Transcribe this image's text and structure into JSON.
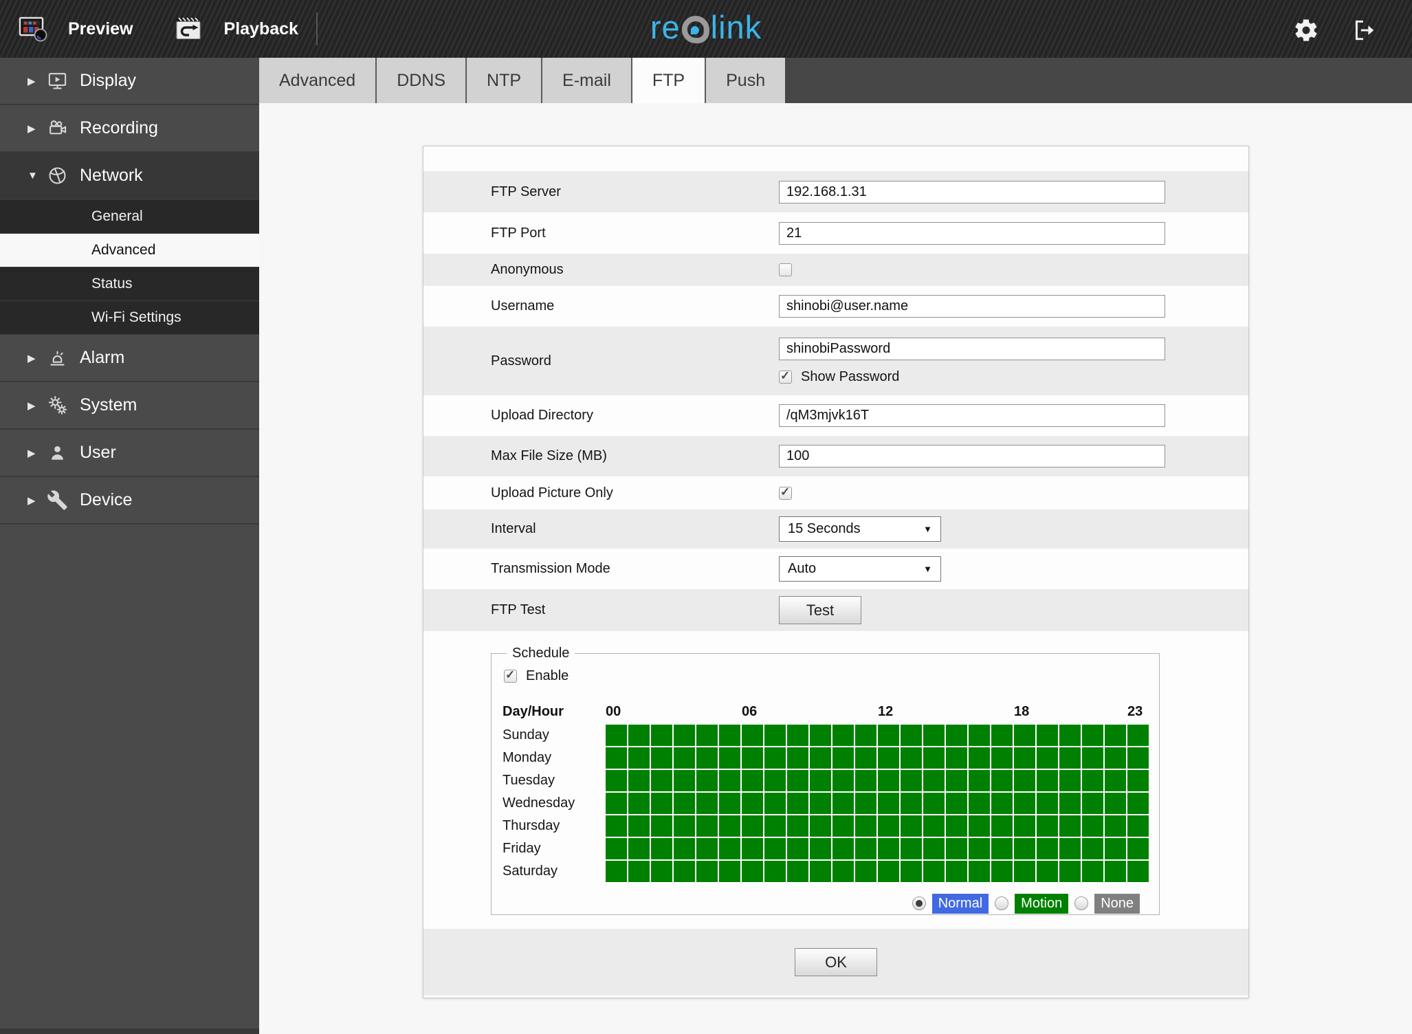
{
  "topbar": {
    "preview_label": "Preview",
    "playback_label": "Playback",
    "brand": {
      "left": "re",
      "o": "o",
      "right": "link",
      "full": "reolink"
    },
    "icons": [
      "preview-icon",
      "playback-icon",
      "settings-gear-icon",
      "logout-icon"
    ]
  },
  "sidebar": {
    "items": [
      {
        "label": "Display",
        "icon": "display-icon",
        "expanded": false
      },
      {
        "label": "Recording",
        "icon": "recording-icon",
        "expanded": false
      },
      {
        "label": "Network",
        "icon": "network-icon",
        "expanded": true,
        "children": [
          {
            "label": "General",
            "selected": false
          },
          {
            "label": "Advanced",
            "selected": true
          },
          {
            "label": "Status",
            "selected": false
          },
          {
            "label": "Wi-Fi Settings",
            "selected": false
          }
        ]
      },
      {
        "label": "Alarm",
        "icon": "alarm-icon",
        "expanded": false
      },
      {
        "label": "System",
        "icon": "system-icon",
        "expanded": false
      },
      {
        "label": "User",
        "icon": "user-icon",
        "expanded": false
      },
      {
        "label": "Device",
        "icon": "device-icon",
        "expanded": false
      }
    ]
  },
  "tabs": {
    "items": [
      "Advanced",
      "DDNS",
      "NTP",
      "E-mail",
      "FTP",
      "Push"
    ],
    "active": "FTP"
  },
  "form": {
    "rows": [
      {
        "label": "FTP Server",
        "type": "text",
        "value": "192.168.1.31"
      },
      {
        "label": "FTP Port",
        "type": "text",
        "value": "21"
      },
      {
        "label": "Anonymous",
        "type": "checkbox",
        "checked": false
      },
      {
        "label": "Username",
        "type": "text",
        "value": "shinobi@user.name"
      },
      {
        "label": "Password",
        "type": "text",
        "value": "shinobiPassword",
        "sub": {
          "label": "Show Password",
          "checked": true
        }
      },
      {
        "label": "Upload Directory",
        "type": "text",
        "value": "/qM3mjvk16T"
      },
      {
        "label": "Max File Size (MB)",
        "type": "text",
        "value": "100"
      },
      {
        "label": "Upload Picture Only",
        "type": "checkbox",
        "checked": true
      },
      {
        "label": "Interval",
        "type": "select",
        "value": "15 Seconds"
      },
      {
        "label": "Transmission Mode",
        "type": "select",
        "value": "Auto"
      },
      {
        "label": "FTP Test",
        "type": "button",
        "button_label": "Test"
      }
    ]
  },
  "schedule": {
    "legend": "Schedule",
    "enable_label": "Enable",
    "enable_checked": true,
    "day_hour_label": "Day/Hour",
    "hour_ticks": [
      {
        "label": "00",
        "col": 0
      },
      {
        "label": "06",
        "col": 6
      },
      {
        "label": "12",
        "col": 12
      },
      {
        "label": "18",
        "col": 18
      },
      {
        "label": "23",
        "col": 23
      }
    ],
    "days": [
      "Sunday",
      "Monday",
      "Tuesday",
      "Wednesday",
      "Thursday",
      "Friday",
      "Saturday"
    ],
    "columns": 24,
    "cells_filled": true,
    "fill_state": "motion",
    "grid_color": "#008000",
    "modes": [
      {
        "label": "Normal",
        "color": "#4169e1",
        "selected": true
      },
      {
        "label": "Motion",
        "color": "#008000",
        "selected": false
      },
      {
        "label": "None",
        "color": "#808080",
        "selected": false
      }
    ]
  },
  "ok_label": "OK"
}
